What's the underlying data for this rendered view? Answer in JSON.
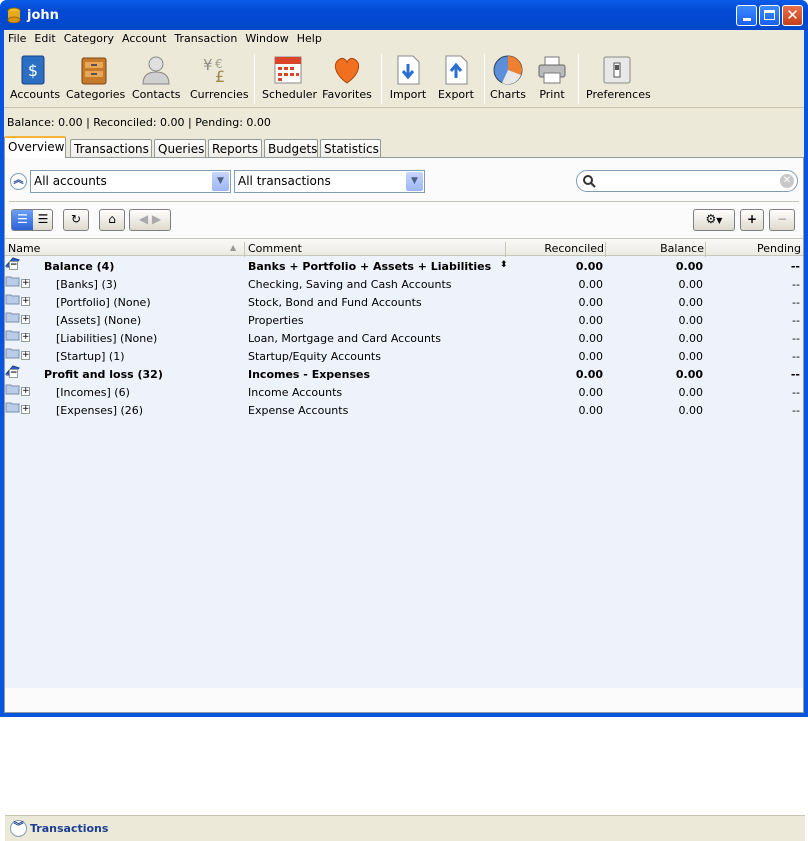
{
  "window": {
    "title": "john"
  },
  "menu": [
    "File",
    "Edit",
    "Category",
    "Account",
    "Transaction",
    "Window",
    "Help"
  ],
  "toolbar": [
    {
      "label": "Accounts",
      "icon": "accounts-icon"
    },
    {
      "label": "Categories",
      "icon": "categories-icon"
    },
    {
      "label": "Contacts",
      "icon": "contacts-icon"
    },
    {
      "label": "Currencies",
      "icon": "currencies-icon"
    },
    {
      "label": "Scheduler",
      "icon": "scheduler-icon"
    },
    {
      "label": "Favorites",
      "icon": "favorites-icon"
    },
    {
      "label": "Import",
      "icon": "import-icon"
    },
    {
      "label": "Export",
      "icon": "export-icon"
    },
    {
      "label": "Charts",
      "icon": "charts-icon"
    },
    {
      "label": "Print",
      "icon": "print-icon"
    },
    {
      "label": "Preferences",
      "icon": "preferences-icon"
    }
  ],
  "status": "Balance: 0.00 | Reconciled: 0.00 | Pending: 0.00",
  "tabs": [
    "Overview",
    "Transactions",
    "Queries",
    "Reports",
    "Budgets",
    "Statistics"
  ],
  "filters": {
    "accounts": "All accounts",
    "transactions": "All transactions",
    "search_value": ""
  },
  "grid": {
    "headers": {
      "name": "Name",
      "comment": "Comment",
      "reconciled": "Reconciled",
      "balance": "Balance",
      "pending": "Pending"
    },
    "rows": [
      {
        "level": 0,
        "name": "Balance (4)",
        "comment": "Banks + Portfolio + Assets + Liabilities",
        "reconciled": "0.00",
        "balance": "0.00",
        "pending": "--",
        "bold": true,
        "expander": "⊟"
      },
      {
        "level": 1,
        "name": "[Banks] (3)",
        "comment": "Checking, Saving and Cash Accounts",
        "reconciled": "0.00",
        "balance": "0.00",
        "pending": "--",
        "bold": false,
        "expander": "+"
      },
      {
        "level": 1,
        "name": "[Portfolio] (None)",
        "comment": "Stock, Bond and Fund Accounts",
        "reconciled": "0.00",
        "balance": "0.00",
        "pending": "--",
        "bold": false,
        "expander": "+"
      },
      {
        "level": 1,
        "name": "[Assets] (None)",
        "comment": "Properties",
        "reconciled": "0.00",
        "balance": "0.00",
        "pending": "--",
        "bold": false,
        "expander": "+"
      },
      {
        "level": 1,
        "name": "[Liabilities] (None)",
        "comment": "Loan, Mortgage and Card Accounts",
        "reconciled": "0.00",
        "balance": "0.00",
        "pending": "--",
        "bold": false,
        "expander": "+"
      },
      {
        "level": 1,
        "name": "[Startup] (1)",
        "comment": "Startup/Equity Accounts",
        "reconciled": "0.00",
        "balance": "0.00",
        "pending": "--",
        "bold": false,
        "expander": "+"
      },
      {
        "level": 0,
        "name": "Profit and loss (32)",
        "comment": "Incomes - Expenses",
        "reconciled": "0.00",
        "balance": "0.00",
        "pending": "--",
        "bold": true,
        "expander": "⊟"
      },
      {
        "level": 1,
        "name": "[Incomes] (6)",
        "comment": "Income Accounts",
        "reconciled": "0.00",
        "balance": "0.00",
        "pending": "--",
        "bold": false,
        "expander": "+"
      },
      {
        "level": 1,
        "name": "[Expenses] (26)",
        "comment": "Expense Accounts",
        "reconciled": "0.00",
        "balance": "0.00",
        "pending": "--",
        "bold": false,
        "expander": "+"
      }
    ]
  },
  "bottom": {
    "label": "Transactions"
  }
}
